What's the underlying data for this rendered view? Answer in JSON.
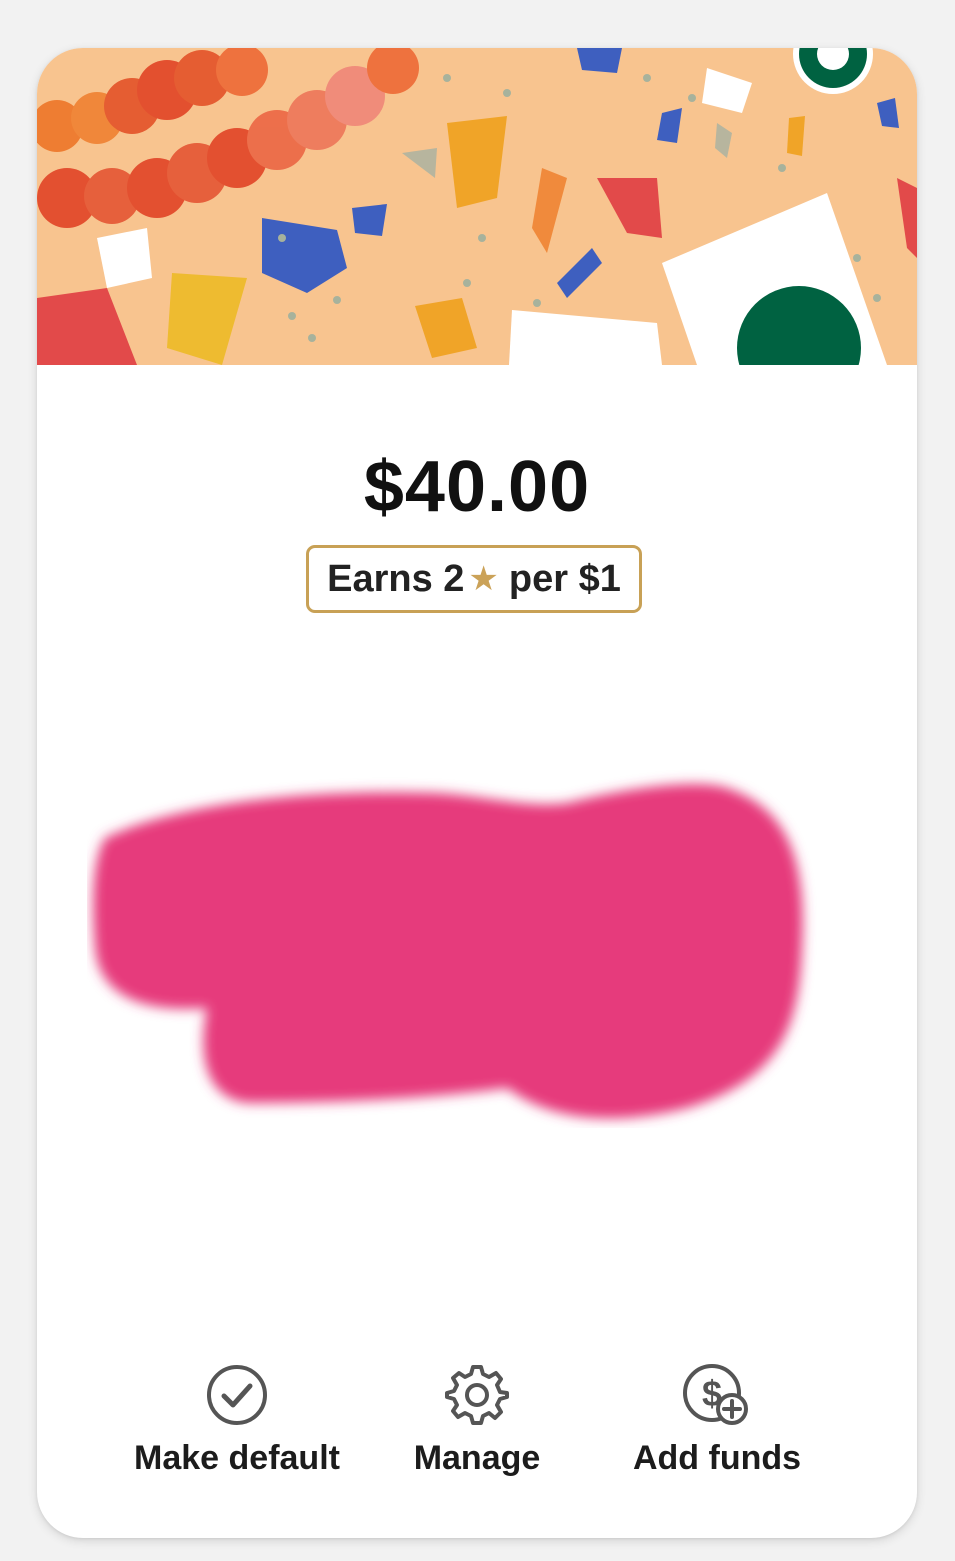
{
  "card": {
    "balance": "$40.00",
    "earns": {
      "prefix": "Earns 2",
      "star_icon": "star-icon",
      "suffix": "per $1"
    },
    "accent_color": "#c8a156",
    "redaction_color": "#e63a7b"
  },
  "actions": [
    {
      "label": "Make default",
      "icon": "check-circle-icon"
    },
    {
      "label": "Manage",
      "icon": "gear-icon"
    },
    {
      "label": "Add funds",
      "icon": "dollar-plus-icon"
    }
  ]
}
